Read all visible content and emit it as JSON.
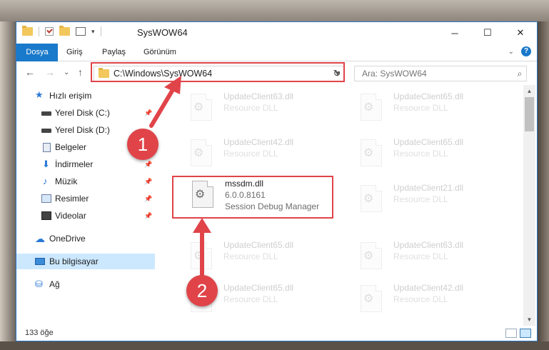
{
  "window": {
    "title": "SysWOW64",
    "minimize_glyph": "─",
    "maximize_glyph": "☐",
    "close_glyph": "✕"
  },
  "ribbon": {
    "tabs": [
      "Dosya",
      "Giriş",
      "Paylaş",
      "Görünüm"
    ],
    "collapse_glyph": "⌄",
    "help_glyph": "?"
  },
  "nav": {
    "back_glyph": "←",
    "forward_glyph": "→",
    "recent_glyph": "⌄",
    "up_glyph": "↑",
    "address": "C:\\Windows\\SysWOW64",
    "refresh_glyph": "↻",
    "search_placeholder": "Ara: SysWOW64",
    "search_glyph": "⌕"
  },
  "sidebar": {
    "items": [
      {
        "label": "Hızlı erişim",
        "icon": "star-icon"
      },
      {
        "label": "Yerel Disk (C:)",
        "icon": "drive-icon",
        "pinned": true
      },
      {
        "label": "Yerel Disk (D:)",
        "icon": "drive-icon"
      },
      {
        "label": "Belgeler",
        "icon": "documents-icon"
      },
      {
        "label": "İndirmeler",
        "icon": "downloads-icon",
        "pinned": true
      },
      {
        "label": "Müzik",
        "icon": "music-icon",
        "pinned": true
      },
      {
        "label": "Resimler",
        "icon": "pictures-icon",
        "pinned": true
      },
      {
        "label": "Videolar",
        "icon": "videos-icon",
        "pinned": true
      },
      {
        "label": "OneDrive",
        "icon": "onedrive-icon"
      },
      {
        "label": "Bu bilgisayar",
        "icon": "this-pc-icon",
        "selected": true
      },
      {
        "label": "Ağ",
        "icon": "network-icon"
      }
    ],
    "pin_glyph": "📌"
  },
  "files": {
    "col1": [
      {
        "name": "UpdateClient63.dll",
        "desc": "Resource DLL"
      },
      {
        "name": "UpdateClient42.dll",
        "desc": "Resource DLL"
      },
      {
        "name": "mssdm.dll",
        "version": "6.0.0.8161",
        "desc": "Session Debug Manager"
      },
      {
        "name": "UpdateClient65.dll",
        "desc": "Resource DLL"
      },
      {
        "name": "UpdateClient65.dll",
        "desc": "Resource DLL"
      }
    ],
    "col2": [
      {
        "name": "UpdateClient65.dll",
        "desc": "Resource DLL"
      },
      {
        "name": "UpdateClient65.dll",
        "desc": "Resource DLL"
      },
      {
        "name": "UpdateClient21.dll",
        "desc": "Resource DLL"
      },
      {
        "name": "UpdateClient63.dll",
        "desc": "Resource DLL"
      },
      {
        "name": "UpdateClient42.dll",
        "desc": "Resource DLL"
      }
    ],
    "gear_glyph": "⚙"
  },
  "status": {
    "count": "133 öğe"
  },
  "annotations": {
    "badge1": "1",
    "badge2": "2",
    "color": "#e04449"
  }
}
